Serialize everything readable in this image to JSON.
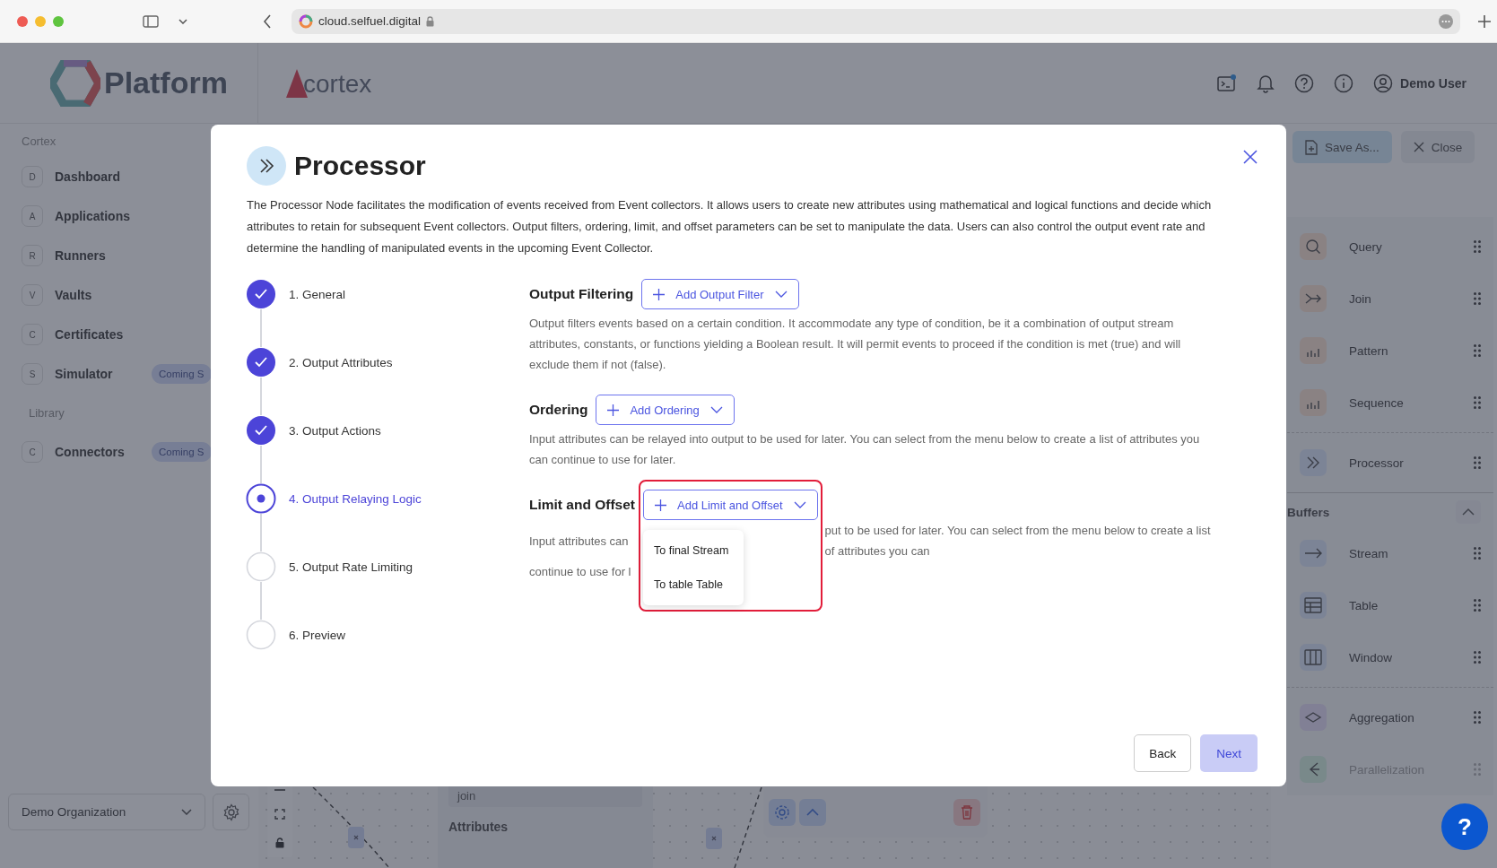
{
  "browser": {
    "url": "cloud.selfuel.digital"
  },
  "header": {
    "logo": "Platform",
    "product": "cortex",
    "user": "Demo User"
  },
  "sidebar": {
    "section": "Cortex",
    "items": [
      {
        "letter": "D",
        "label": "Dashboard"
      },
      {
        "letter": "A",
        "label": "Applications"
      },
      {
        "letter": "R",
        "label": "Runners"
      },
      {
        "letter": "V",
        "label": "Vaults"
      },
      {
        "letter": "C",
        "label": "Certificates"
      },
      {
        "letter": "S",
        "label": "Simulator",
        "badge": "Coming S"
      }
    ],
    "library_section": "Library",
    "library_items": [
      {
        "letter": "C",
        "label": "Connectors",
        "badge": "Coming S"
      }
    ],
    "organization": "Demo Organization"
  },
  "toolbar": {
    "buttons": [
      {
        "label": "Save As...",
        "kind": "save"
      },
      {
        "label": "Close",
        "kind": "close"
      }
    ]
  },
  "palette": {
    "groups": [
      {
        "items": [
          {
            "label": "Query",
            "kind": "query",
            "disabled": false
          },
          {
            "label": "Join",
            "kind": "join",
            "disabled": false
          },
          {
            "label": "Pattern",
            "kind": "pattern",
            "disabled": false
          },
          {
            "label": "Sequence",
            "kind": "sequence",
            "disabled": false
          }
        ]
      },
      {
        "items": [
          {
            "label": "Processor",
            "kind": "processor",
            "disabled": false
          }
        ]
      }
    ],
    "buffers": {
      "title": "Buffers",
      "expanded": true,
      "items": [
        {
          "label": "Stream",
          "kind": "stream",
          "disabled": false
        },
        {
          "label": "Table",
          "kind": "table",
          "disabled": false
        },
        {
          "label": "Window",
          "kind": "window",
          "disabled": false
        }
      ]
    },
    "more": [
      {
        "label": "Aggregation",
        "kind": "aggregation",
        "disabled": false
      },
      {
        "label": "Parallelization",
        "kind": "parallel",
        "disabled": true
      }
    ]
  },
  "canvas": {
    "node_field": "join",
    "attributes_label": "Attributes"
  },
  "help": {
    "label": "?"
  },
  "modal": {
    "title": "Processor",
    "description": "The Processor Node facilitates the modification of events received from Event collectors. It allows users to create new attributes using mathematical and logical functions and decide which attributes to retain for subsequent Event collectors. Output filters, ordering, limit, and offset parameters can be set to manipulate the data. Users can also control the output event rate and determine the handling of manipulated events in the upcoming Event Collector.",
    "steps": [
      {
        "label": "1. General",
        "completed": true,
        "selected": false
      },
      {
        "label": "2. Output Attributes",
        "completed": true,
        "selected": false
      },
      {
        "label": "3. Output Actions",
        "completed": true,
        "selected": false
      },
      {
        "label": "4. Output Relaying Logic",
        "completed": false,
        "selected": true
      },
      {
        "label": "5. Output Rate Limiting",
        "completed": false,
        "selected": false
      },
      {
        "label": "6. Preview",
        "completed": false,
        "selected": false
      }
    ],
    "sections": [
      {
        "title": "Output Filtering",
        "button": "Add Output Filter",
        "expanded": false,
        "highlighted": false,
        "description": "Output filters events based on a certain condition. It accommodate any type of condition, be it a combination of output stream attributes, constants, or functions yielding a Boolean result. It will permit events to proceed if the condition is met (true) and will exclude them if not (false)."
      },
      {
        "title": "Ordering",
        "button": "Add Ordering",
        "expanded": false,
        "highlighted": false,
        "description": "Input attributes can be relayed into output to be used for later. You can select from the menu below to create a list of attributes you can continue to use for later."
      },
      {
        "title": "Limit and Offset",
        "button": "Add Limit and Offset",
        "expanded": true,
        "highlighted": true,
        "description_parts": [
          "Input attributes can",
          "put to be used for later. You can select from the menu below to create a list of attributes you can",
          "continue to use for l"
        ],
        "menu": [
          "To final Stream",
          "To table Table"
        ]
      }
    ],
    "buttons": [
      {
        "label": "Back",
        "kind": "secondary"
      },
      {
        "label": "Next",
        "kind": "primary"
      }
    ]
  }
}
